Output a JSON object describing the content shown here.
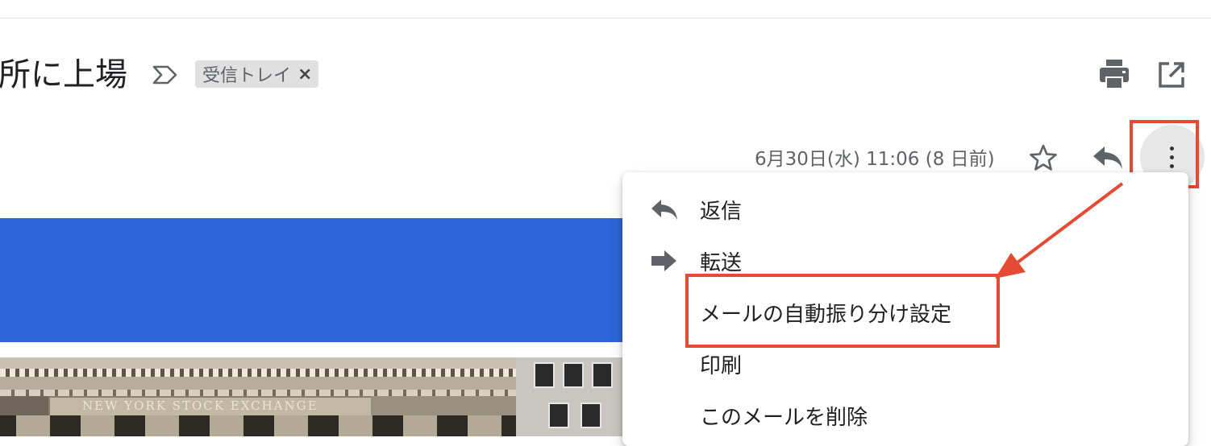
{
  "email": {
    "subject_fragment": "所に上場",
    "label_chip": "受信トレイ",
    "label_remove": "×",
    "date": "6月30日(水) 11:06 (8 日前)"
  },
  "photo": {
    "inscription": "NEW YORK STOCK EXCHANGE"
  },
  "menu": {
    "items": [
      {
        "label": "返信",
        "icon": "reply-icon"
      },
      {
        "label": "転送",
        "icon": "forward-icon"
      },
      {
        "label": "メールの自動振り分け設定",
        "icon": ""
      },
      {
        "label": "印刷",
        "icon": ""
      },
      {
        "label": "このメールを削除",
        "icon": ""
      }
    ]
  },
  "icons": [
    "important-icon",
    "print-icon",
    "popout-icon",
    "star-icon",
    "reply-icon",
    "more-vert-icon",
    "forward-icon"
  ],
  "colors": {
    "banner": "#2c66d9",
    "annotation": "#e54a33",
    "chip_bg": "#e0e0e0",
    "icon": "#5f6368"
  }
}
